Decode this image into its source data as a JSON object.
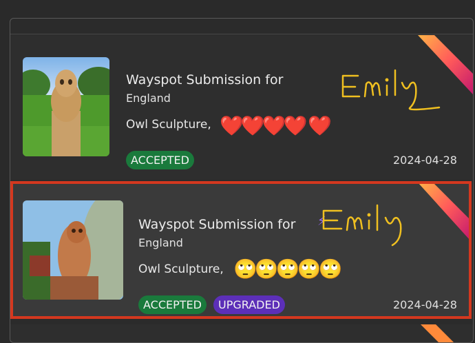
{
  "submissions": [
    {
      "title": "Wayspot Submission for",
      "location": "England",
      "description": "Owl Sculpture, ",
      "emojis": "❤️❤️❤️❤️ ❤️",
      "badges": [
        "ACCEPTED"
      ],
      "date": "2024-04-28"
    },
    {
      "title": "Wayspot Submission for",
      "location": "England",
      "description": "Owl Sculpture, ",
      "emojis": "🙄🙄🙄🙄🙄",
      "badges": [
        "ACCEPTED",
        "UPGRADED"
      ],
      "date": "2024-04-28"
    }
  ],
  "annotation": "Emily",
  "colors": {
    "accepted": "#1a7a3c",
    "upgraded": "#5c2fb8",
    "highlight_border": "#d4381f",
    "handwriting": "#f0c020"
  },
  "icons": {
    "upgrade": "lightning-bolt-icon"
  }
}
